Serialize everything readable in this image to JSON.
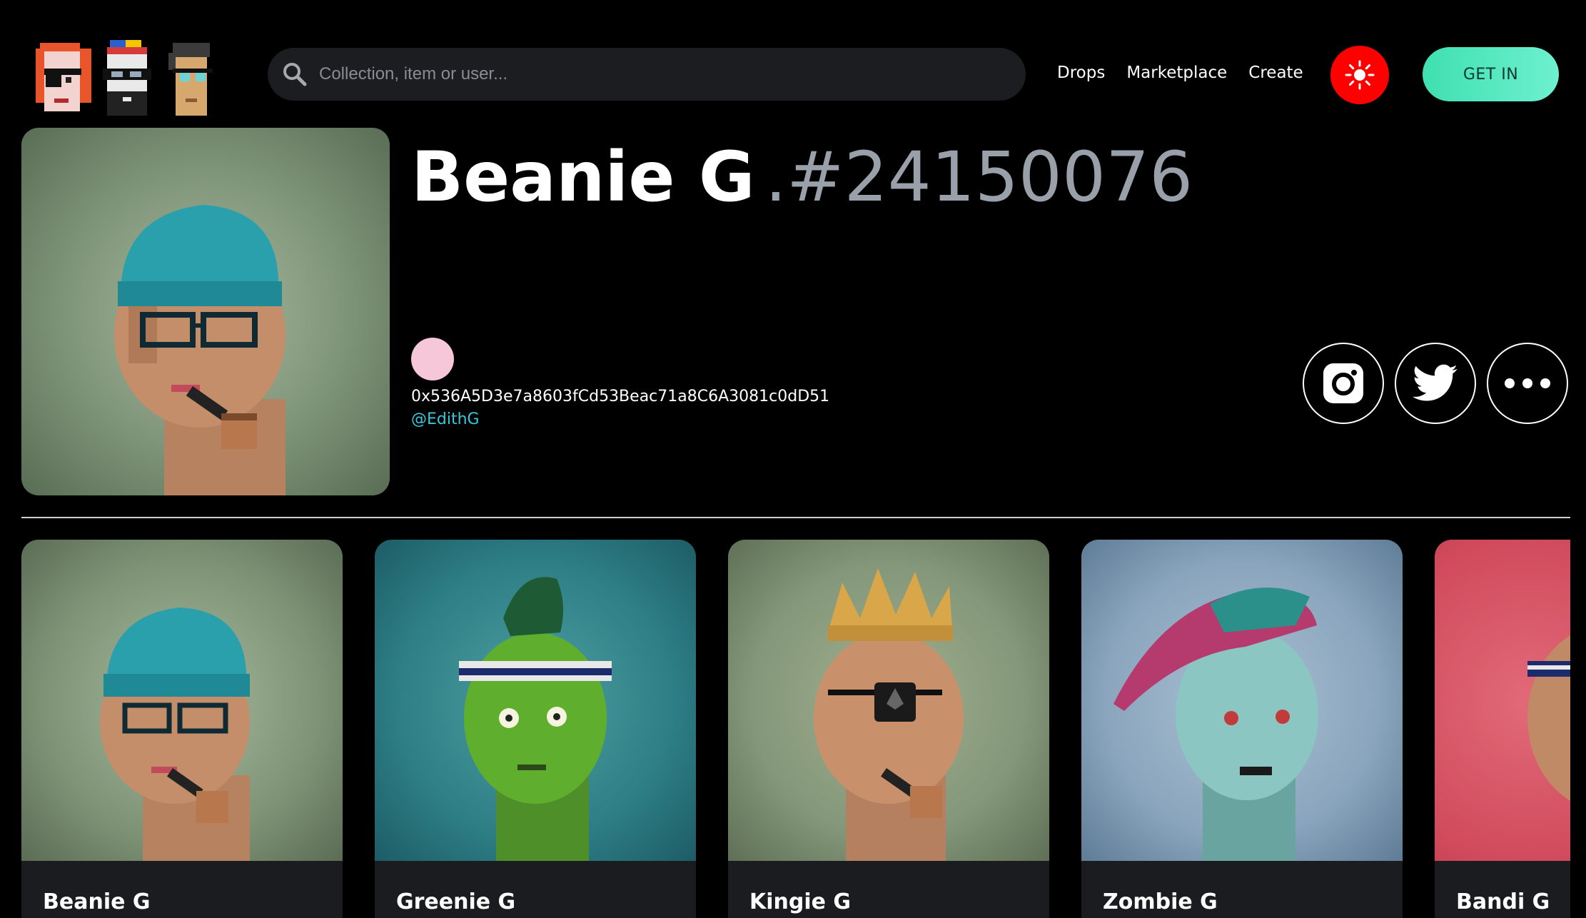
{
  "header": {
    "search": {
      "placeholder": "Collection, item or user..."
    },
    "nav": [
      "Drops",
      "Marketplace",
      "Create"
    ],
    "get_in_label": "GET IN",
    "theme_color": "#ff0000",
    "accent_color": "#4ff0c2"
  },
  "hero": {
    "name": "Beanie G",
    "token_id": ".#24150076",
    "owner_address": "0x536A5D3e7a8603fCd53Beac71a8C6A3081c0dD51",
    "owner_handle": "@EdithG",
    "social": [
      "instagram-icon",
      "twitter-icon",
      "more-icon"
    ]
  },
  "cards": [
    {
      "name": "Beanie G",
      "bg": "#8fa385"
    },
    {
      "name": "Greenie G",
      "bg": "#3b8a8e"
    },
    {
      "name": "Kingie G",
      "bg": "#8a9c7a"
    },
    {
      "name": "Zombie G",
      "bg": "#88a0b8"
    },
    {
      "name": "Bandi G",
      "bg": "#d44a5e"
    }
  ]
}
